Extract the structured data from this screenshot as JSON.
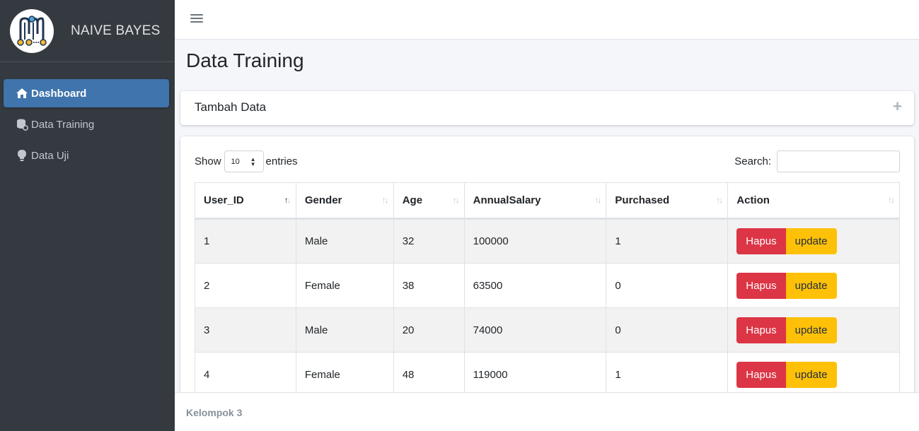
{
  "brand": {
    "name": "NAIVE BAYES"
  },
  "sidebar": {
    "items": [
      {
        "label": "Dashboard",
        "icon": "home-icon",
        "active": true
      },
      {
        "label": "Data Training",
        "icon": "database-icon",
        "active": false
      },
      {
        "label": "Data Uji",
        "icon": "lightbulb-icon",
        "active": false
      }
    ]
  },
  "page": {
    "title": "Data Training"
  },
  "add_card": {
    "title": "Tambah Data",
    "tool": "+"
  },
  "table_controls": {
    "show_label": "Show",
    "entries_value": "10",
    "entries_label": "entries",
    "search_label": "Search:",
    "search_value": ""
  },
  "table": {
    "headers": [
      "User_ID",
      "Gender",
      "Age",
      "AnnualSalary",
      "Purchased",
      "Action"
    ],
    "rows": [
      {
        "user_id": "1",
        "gender": "Male",
        "age": "32",
        "salary": "100000",
        "purchased": "1"
      },
      {
        "user_id": "2",
        "gender": "Female",
        "age": "38",
        "salary": "63500",
        "purchased": "0"
      },
      {
        "user_id": "3",
        "gender": "Male",
        "age": "20",
        "salary": "74000",
        "purchased": "0"
      },
      {
        "user_id": "4",
        "gender": "Female",
        "age": "48",
        "salary": "119000",
        "purchased": "1"
      }
    ],
    "delete_label": "Hapus",
    "update_label": "update"
  },
  "footer": {
    "text": "Kelompok 3"
  },
  "colors": {
    "sidebar_bg": "#343a40",
    "active_nav": "#3f74ad",
    "danger": "#dc3545",
    "warning": "#ffc107"
  }
}
